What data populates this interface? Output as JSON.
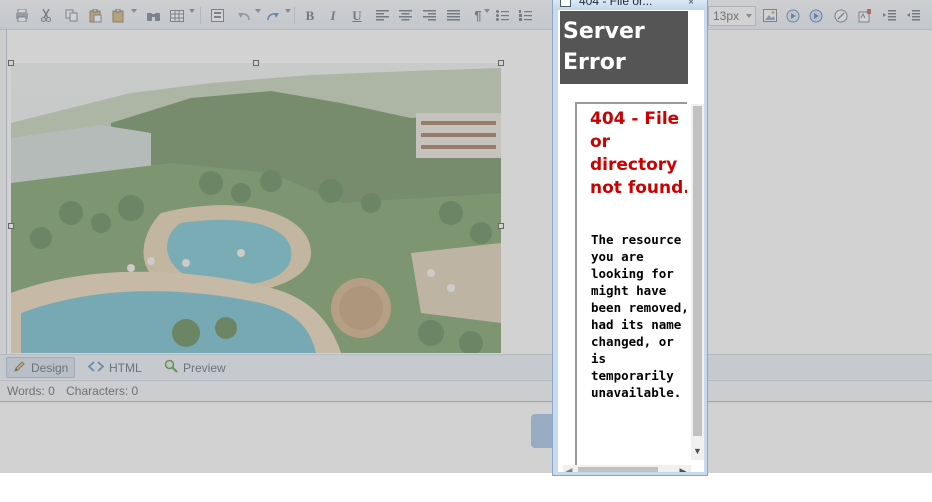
{
  "colors": {
    "dim_overlay": "#a0a0a0",
    "error_header_bg": "#555555",
    "error_title": "#cc0000",
    "popup_frame": "#c8daee"
  },
  "toolbar": {
    "icons": [
      "print-icon",
      "cut-icon",
      "copy-icon",
      "paste-icon",
      "paste-options-icon",
      "find-icon",
      "table-icon",
      "form-icon",
      "undo-icon",
      "redo-icon",
      "bold-icon",
      "italic-icon",
      "underline-icon",
      "align-left-icon",
      "align-center-icon",
      "align-right-icon",
      "justify-icon",
      "paragraph-icon",
      "bullet-list-icon",
      "numbered-list-icon",
      "image-icon",
      "media-icon",
      "flash-icon",
      "link-icon",
      "spellcheck-icon",
      "indent-icon",
      "outdent-icon"
    ],
    "bold_glyph": "B",
    "italic_glyph": "I",
    "underline_glyph": "U",
    "paragraph_glyph": "¶",
    "font_size": "13px"
  },
  "modes": {
    "design": "Design",
    "html": "HTML",
    "preview": "Preview",
    "active": "design"
  },
  "status": {
    "words": "Words: 0",
    "characters": "Characters: 0"
  },
  "popup": {
    "title": "404 - File or...",
    "close_glyph": "×",
    "header": "Server Error",
    "error_title": "404 - File or directory not found.",
    "error_description": "The resource you are looking for might have been removed, had its name changed, or is temporarily unavailable.",
    "scroll_down_glyph": "▼",
    "scroll_left_glyph": "◀",
    "scroll_right_glyph": "▶"
  }
}
